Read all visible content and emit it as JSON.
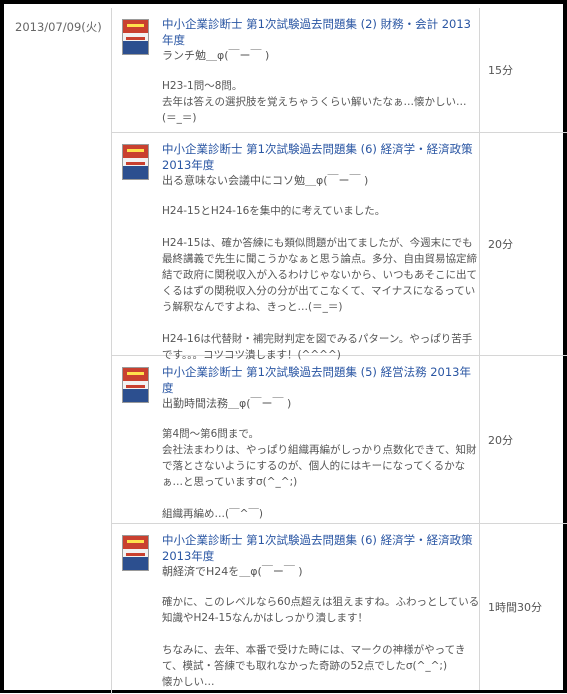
{
  "date": "2013/07/09(火)",
  "entries": [
    {
      "title": "中小企業診断士 第1次試験過去問題集 (2) 財務・会計 2013年度",
      "headline": "ランチ勉＿φ(￣ー￣ )",
      "memo": "H23-1問～8問。\n去年は答えの選択肢を覚えちゃうくらい解いたなぁ…懐かしい…(＝_＝)",
      "time": "15分"
    },
    {
      "title": "中小企業診断士 第1次試験過去問題集 (6) 経済学・経済政策 2013年度",
      "headline": "出る意味ない会議中にコソ勉＿φ(￣ー￣ )",
      "memo": "H24-15とH24-16を集中的に考えていました。\n\nH24-15は、確か答練にも類似問題が出てましたが、今週末にでも最終講義で先生に聞こうかなぁと思う論点。多分、自由貿易協定締結で政府に関税収入が入るわけじゃないから、いつもあそこに出てくるはずの関税収入分の分が出てこなくて、マイナスになるっていう解釈なんですよね、きっと…(＝_＝)\n\nH24-16は代替財・補完財判定を図でみるパターン。やっぱり苦手です。。。コツコツ潰します！(^^^^)",
      "time": "20分"
    },
    {
      "title": "中小企業診断士 第1次試験過去問題集 (5) 経営法務 2013年度",
      "headline": "出勤時間法務＿φ(￣ー￣ )",
      "memo": "第4問～第6問まで。\n会社法まわりは、やっぱり組織再編がしっかり点数化できて、知財で落とさないようにするのが、個人的にはキーになってくるかなぁ…と思っていますσ(^_^;)\n\n組織再編め…(￣^￣)",
      "time": "20分"
    },
    {
      "title": "中小企業診断士 第1次試験過去問題集 (6) 経済学・経済政策 2013年度",
      "headline": "朝経済でH24を＿φ(￣ー￣ )",
      "memo": "確かに、このレベルなら60点超えは狙えますね。ふわっとしている知識やH24-15なんかはしっかり潰します！\n\nちなみに、去年、本番で受けた時には、マークの神様がやってきて、模試・答練でも取れなかった奇跡の52点でしたσ(^_^;)\n懐かしい…",
      "time": "1時間30分"
    }
  ]
}
